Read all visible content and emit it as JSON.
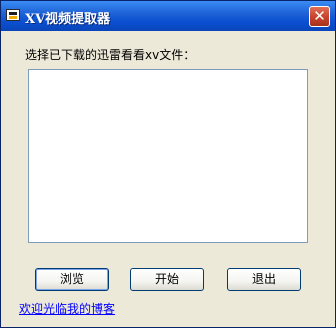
{
  "window": {
    "title": "XV视频提取器",
    "close_glyph": "✕"
  },
  "main": {
    "prompt_label": "选择已下载的迅雷看看xv文件：",
    "file_list_items": []
  },
  "buttons": {
    "browse_label": "浏览",
    "start_label": "开始",
    "exit_label": "退出"
  },
  "footer": {
    "blog_link_label": "欢迎光临我的博客"
  },
  "colors": {
    "titlebar": "#0B4FD1",
    "window_face": "#ECE9D8",
    "link": "#0000FF"
  }
}
